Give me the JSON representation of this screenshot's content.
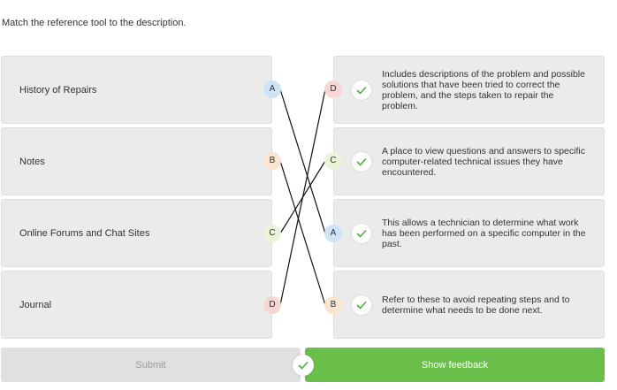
{
  "instruction": "Match the reference tool to the description.",
  "left_items": [
    {
      "label": "History of Repairs",
      "letter": "A",
      "color": "#cfe3f7"
    },
    {
      "label": "Notes",
      "letter": "B",
      "color": "#fae4d2"
    },
    {
      "label": "Online Forums and Chat Sites",
      "letter": "C",
      "color": "#eaf4d9"
    },
    {
      "label": "Journal",
      "letter": "D",
      "color": "#f8d6d6"
    }
  ],
  "right_items": [
    {
      "letter": "D",
      "color": "#f8d6d6",
      "desc": "Includes descriptions of the problem and possible solutions that have been tried to correct the problem, and the steps taken to repair the problem."
    },
    {
      "letter": "C",
      "color": "#eaf4d9",
      "desc": "A place to view questions and answers to specific computer-related technical issues they have encountered."
    },
    {
      "letter": "A",
      "color": "#cfe3f7",
      "desc": "This allows a technician to determine what work has been performed on a specific computer in the past."
    },
    {
      "letter": "B",
      "color": "#fae4d2",
      "desc": "Refer to these to avoid repeating steps and to determine what needs to be done next."
    }
  ],
  "buttons": {
    "submit_label": "Submit",
    "feedback_label": "Show feedback"
  },
  "colors": {
    "check_green": "#4caf3d",
    "feedback_bg": "#6abf4b"
  }
}
